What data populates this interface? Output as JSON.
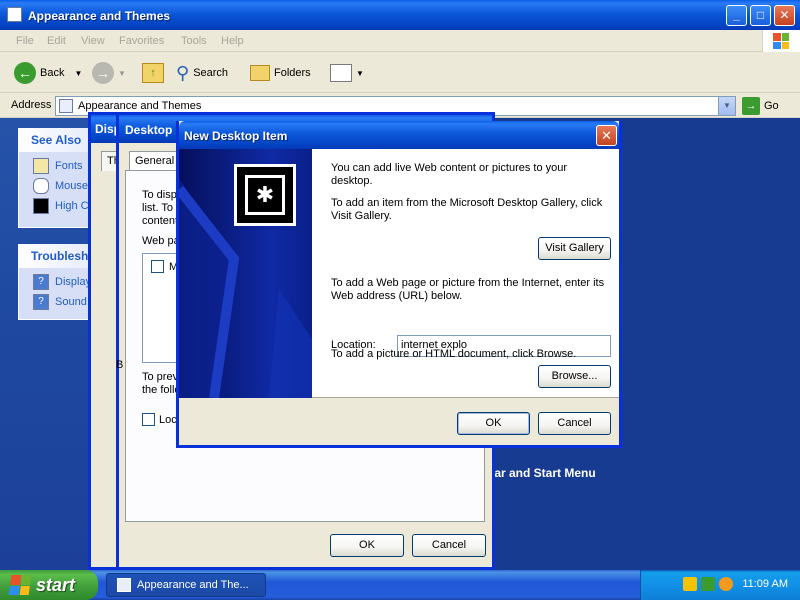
{
  "explorer": {
    "title": "Appearance and Themes",
    "menu": [
      "File",
      "Edit",
      "View",
      "Favorites",
      "Tools",
      "Help"
    ],
    "toolbar": {
      "back": "Back",
      "search": "Search",
      "folders": "Folders"
    },
    "address_label": "Address",
    "address_value": "Appearance and Themes",
    "go": "Go",
    "see_also": {
      "title": "See Also",
      "items": [
        "Fonts",
        "Mouse",
        "High Co"
      ]
    },
    "troubleshooters": {
      "title": "Troublesh",
      "items": [
        "Display",
        "Sound"
      ]
    },
    "content_link": "bar and Start Menu"
  },
  "display_properties": {
    "title": "Disp",
    "tab": "Th"
  },
  "desktop_items": {
    "title": "Desktop It",
    "tab": "General",
    "text1": [
      "To disp",
      "list. To",
      "content"
    ],
    "web_label": "Web pa",
    "list_item": "M",
    "text2": [
      "To prev",
      "the follo"
    ],
    "lock_label": "Loc",
    "left_letter": "B",
    "ok": "OK",
    "cancel": "Cancel"
  },
  "new_item": {
    "title": "New Desktop Item",
    "msg1": "You can add live Web content or pictures to your desktop.",
    "msg2": "To add an item from the Microsoft Desktop Gallery, click Visit Gallery.",
    "visit_gallery": "Visit Gallery",
    "msg3": "To add a Web page or picture from the Internet, enter its Web address (URL) below.",
    "location_label": "Location:",
    "location_value": "internet explo",
    "msg4": "To add a picture or HTML document, click Browse.",
    "browse": "Browse...",
    "ok": "OK",
    "cancel": "Cancel"
  },
  "taskbar": {
    "start": "start",
    "task": "Appearance and The...",
    "clock": "11:09 AM"
  }
}
